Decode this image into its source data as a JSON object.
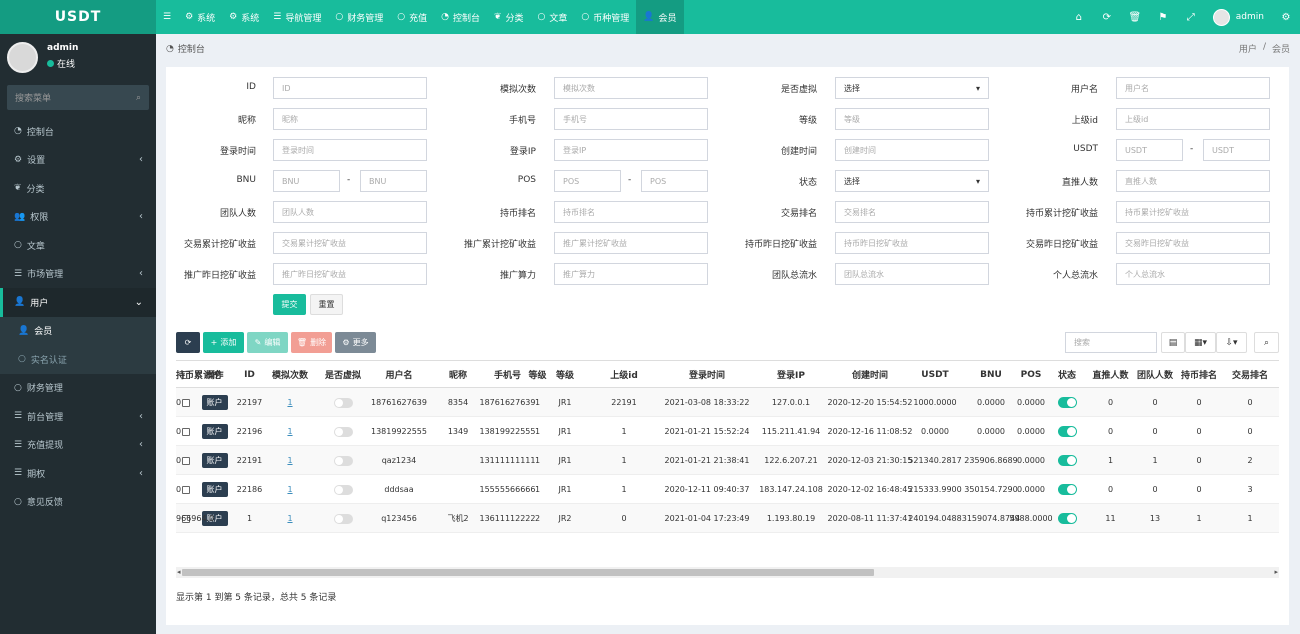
{
  "app": {
    "logo": "USDT",
    "accent": "#18bc9c",
    "accent_dark": "#149c82",
    "sidebar_bg": "#222d32"
  },
  "topnav": [
    {
      "label": "系统",
      "icon": "gears-icon"
    },
    {
      "label": "系统",
      "icon": "gears-icon"
    },
    {
      "label": "导航管理",
      "icon": "list-icon"
    },
    {
      "label": "财务管理",
      "icon": "circle-icon"
    },
    {
      "label": "充值",
      "icon": "circle-icon"
    },
    {
      "label": "控制台",
      "icon": "dashboard-icon"
    },
    {
      "label": "分类",
      "icon": "leaf-icon"
    },
    {
      "label": "文章",
      "icon": "circle-icon"
    },
    {
      "label": "币种管理",
      "icon": "circle-icon"
    },
    {
      "label": "会员",
      "icon": "user-icon"
    }
  ],
  "topright": {
    "username": "admin"
  },
  "sidebar": {
    "username": "admin",
    "status": "在线",
    "search_placeholder": "搜索菜单",
    "items": [
      {
        "label": "控制台",
        "icon": "dashboard-icon"
      },
      {
        "label": "设置",
        "icon": "gears-icon",
        "arrow": "‹"
      },
      {
        "label": "分类",
        "icon": "leaf-icon"
      },
      {
        "label": "权限",
        "icon": "group-icon",
        "arrow": "‹"
      },
      {
        "label": "文章",
        "icon": "circle-icon"
      },
      {
        "label": "市场管理",
        "icon": "list-icon",
        "arrow": "‹"
      },
      {
        "label": "用户",
        "icon": "user-icon",
        "arrow": "⌄"
      },
      {
        "label": "会员",
        "icon": "user-icon"
      },
      {
        "label": "实名认证",
        "icon": "circle-icon"
      },
      {
        "label": "财务管理",
        "icon": "circle-icon"
      },
      {
        "label": "前台管理",
        "icon": "list-icon",
        "arrow": "‹"
      },
      {
        "label": "充值提现",
        "icon": "list-icon",
        "arrow": "‹"
      },
      {
        "label": "期权",
        "icon": "list-icon",
        "arrow": "‹"
      },
      {
        "label": "意见反馈",
        "icon": "circle-icon"
      }
    ]
  },
  "content": {
    "title": "控制台",
    "breadcrumb": [
      "用户",
      "会员"
    ],
    "breadcrumb_sep": "/"
  },
  "filters": {
    "rows": [
      [
        {
          "label": "ID",
          "ph": "ID"
        },
        {
          "label": "模拟次数",
          "ph": "模拟次数"
        },
        {
          "label": "是否虚拟",
          "select": "选择"
        },
        {
          "label": "用户名",
          "ph": "用户名"
        }
      ],
      [
        {
          "label": "昵称",
          "ph": "昵称"
        },
        {
          "label": "手机号",
          "ph": "手机号"
        },
        {
          "label": "等级",
          "ph": "等级"
        },
        {
          "label": "上级id",
          "ph": "上级id"
        }
      ],
      [
        {
          "label": "登录时间",
          "ph": "登录时间"
        },
        {
          "label": "登录IP",
          "ph": "登录IP"
        },
        {
          "label": "创建时间",
          "ph": "创建时间"
        },
        {
          "label": "USDT",
          "range": [
            "USDT",
            "USDT"
          ]
        }
      ],
      [
        {
          "label": "BNU",
          "range": [
            "BNU",
            "BNU"
          ]
        },
        {
          "label": "POS",
          "range": [
            "POS",
            "POS"
          ]
        },
        {
          "label": "状态",
          "select": "选择"
        },
        {
          "label": "直推人数",
          "ph": "直推人数"
        }
      ],
      [
        {
          "label": "团队人数",
          "ph": "团队人数"
        },
        {
          "label": "持币排名",
          "ph": "持币排名"
        },
        {
          "label": "交易排名",
          "ph": "交易排名"
        },
        {
          "label": "持币累计挖矿收益",
          "ph": "持币累计挖矿收益"
        }
      ],
      [
        {
          "label": "交易累计挖矿收益",
          "ph": "交易累计挖矿收益"
        },
        {
          "label": "推广累计挖矿收益",
          "ph": "推广累计挖矿收益"
        },
        {
          "label": "持币昨日挖矿收益",
          "ph": "持币昨日挖矿收益"
        },
        {
          "label": "交易昨日挖矿收益",
          "ph": "交易昨日挖矿收益"
        }
      ],
      [
        {
          "label": "推广昨日挖矿收益",
          "ph": "推广昨日挖矿收益"
        },
        {
          "label": "推广算力",
          "ph": "推广算力"
        },
        {
          "label": "团队总流水",
          "ph": "团队总流水"
        },
        {
          "label": "个人总流水",
          "ph": "个人总流水"
        }
      ]
    ],
    "range_sep": "-",
    "submit": "提交",
    "reset": "重置"
  },
  "toolbar": {
    "add": "添加",
    "edit": "编辑",
    "delete": "删除",
    "more": "更多",
    "search_placeholder": "搜索"
  },
  "table": {
    "headers": [
      "操作",
      "ID",
      "模拟次数",
      "是否虚拟",
      "用户名",
      "昵称",
      "手机号",
      "等级",
      "等级",
      "上级id",
      "登录时间",
      "登录IP",
      "创建时间",
      "USDT",
      "BNU",
      "POS",
      "状态",
      "直推人数",
      "团队人数",
      "持币排名",
      "交易排名",
      "持币累计挖"
    ],
    "account_label": "账户",
    "rows": [
      {
        "id": "22197",
        "sim": "1",
        "virtual": false,
        "username": "18761627639",
        "nick": "8354",
        "phone": "18761627639",
        "level": "1",
        "level2": "JR1",
        "parent": "22191",
        "login_time": "2021-03-08 18:33:22",
        "login_ip": "127.0.0.1",
        "created": "2020-12-20 15:54:52",
        "usdt": "1000.0000",
        "bnu": "0.0000",
        "pos": "0.0000",
        "status": true,
        "direct": "0",
        "team": "0",
        "hold_rank": "0",
        "trade_rank": "0",
        "hold_mine": "0"
      },
      {
        "id": "22196",
        "sim": "1",
        "virtual": false,
        "username": "13819922555",
        "nick": "1349",
        "phone": "13819922555",
        "level": "1",
        "level2": "JR1",
        "parent": "1",
        "login_time": "2021-01-21 15:52:24",
        "login_ip": "115.211.41.94",
        "created": "2020-12-16 11:08:52",
        "usdt": "0.0000",
        "bnu": "0.0000",
        "pos": "0.0000",
        "status": true,
        "direct": "0",
        "team": "0",
        "hold_rank": "0",
        "trade_rank": "0",
        "hold_mine": "0"
      },
      {
        "id": "22191",
        "sim": "1",
        "virtual": false,
        "username": "qaz1234",
        "nick": "",
        "phone": "13111111111",
        "level": "1",
        "level2": "JR1",
        "parent": "1",
        "login_time": "2021-01-21 21:38:41",
        "login_ip": "122.6.207.21",
        "created": "2020-12-03 21:30:15",
        "usdt": "521340.2817",
        "bnu": "235906.8689",
        "pos": "0.0000",
        "status": true,
        "direct": "1",
        "team": "1",
        "hold_rank": "0",
        "trade_rank": "2",
        "hold_mine": "0"
      },
      {
        "id": "22186",
        "sim": "1",
        "virtual": false,
        "username": "dddsaa",
        "nick": "",
        "phone": "15555566666",
        "level": "1",
        "level2": "JR1",
        "parent": "1",
        "login_time": "2020-12-11 09:40:37",
        "login_ip": "183.147.24.108",
        "created": "2020-12-02 16:48:45",
        "usdt": "215333.9900",
        "bnu": "350154.7290",
        "pos": "0.0000",
        "status": true,
        "direct": "0",
        "team": "0",
        "hold_rank": "0",
        "trade_rank": "3",
        "hold_mine": "0"
      },
      {
        "id": "1",
        "sim": "1",
        "virtual": false,
        "username": "q123456",
        "nick": "飞机2",
        "phone": "13611112222",
        "level": "2",
        "level2": "JR2",
        "parent": "0",
        "login_time": "2021-01-04 17:23:49",
        "login_ip": "1.193.80.19",
        "created": "2020-08-11 11:37:41",
        "usdt": "240194.0488",
        "bnu": "3159074.8744",
        "pos": "5988.0000",
        "status": true,
        "direct": "11",
        "team": "13",
        "hold_rank": "1",
        "trade_rank": "1",
        "hold_mine": "966964.0"
      }
    ]
  },
  "footer": "显示第 1 到第 5 条记录，总共 5 条记录"
}
